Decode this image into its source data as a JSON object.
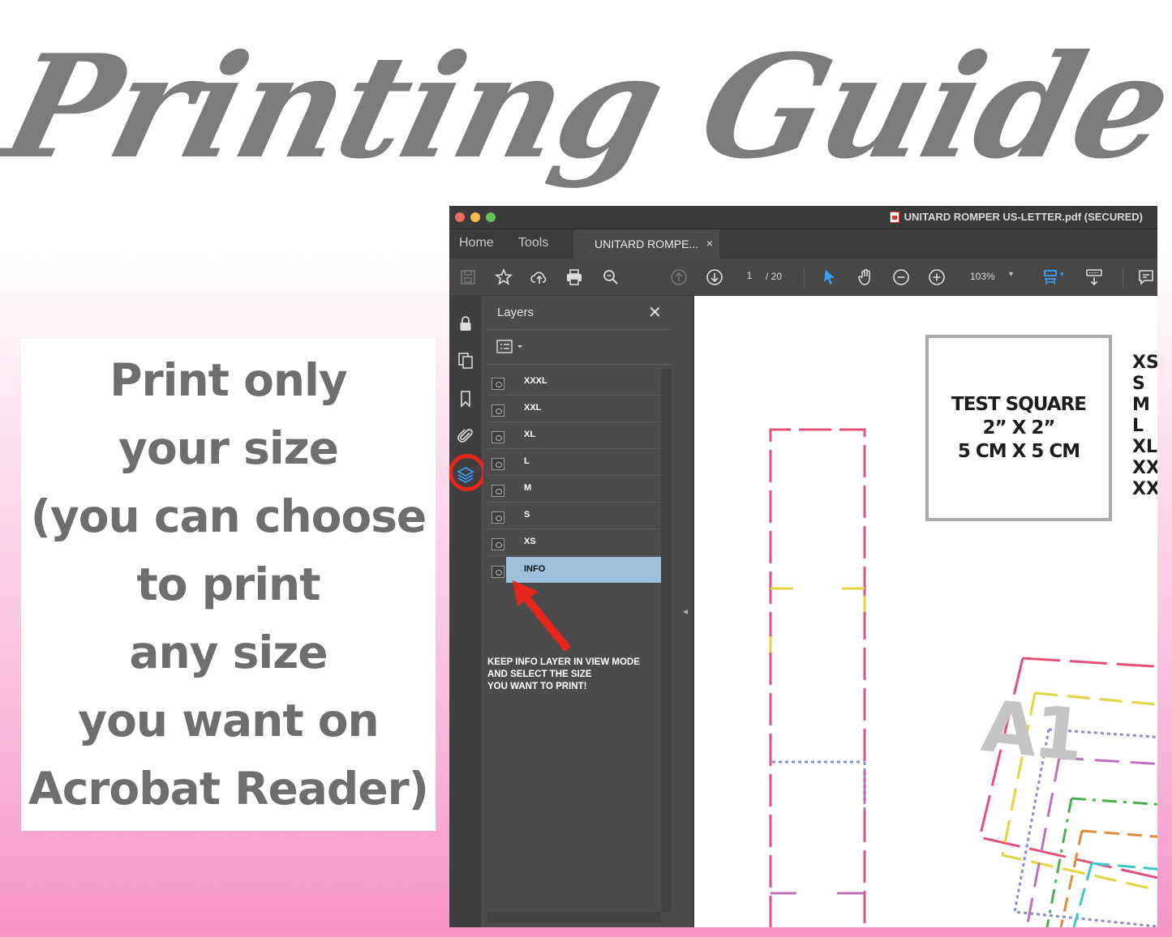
{
  "title": "Printing Guide",
  "card": {
    "lines": [
      "Print only",
      "your size",
      "(you can choose",
      "to print",
      "any size",
      "you want on",
      "Acrobat Reader)"
    ]
  },
  "window": {
    "title": "UNITARD ROMPER US-LETTER.pdf (SECURED)",
    "tabs": {
      "home": "Home",
      "tools": "Tools",
      "document": "UNITARD ROMPE...",
      "close": "×"
    },
    "toolbar": {
      "page_current": "1",
      "page_total": "/ 20",
      "zoom": "103%"
    },
    "layers_panel": {
      "title": "Layers",
      "close": "✕",
      "layers": [
        {
          "name": "XXXL",
          "selected": false
        },
        {
          "name": "XXL",
          "selected": false
        },
        {
          "name": "XL",
          "selected": false
        },
        {
          "name": "L",
          "selected": false
        },
        {
          "name": "M",
          "selected": false
        },
        {
          "name": "S",
          "selected": false
        },
        {
          "name": "XS",
          "selected": false
        },
        {
          "name": "INFO",
          "selected": true
        }
      ],
      "note": [
        "KEEP INFO LAYER IN VIEW MODE",
        "AND SELECT THE SIZE",
        "YOU WANT TO PRINT!"
      ]
    },
    "document": {
      "test_square": [
        "TEST SQUARE",
        "2” X 2”",
        "5 CM X 5 CM"
      ],
      "sizes": [
        "XS",
        "S",
        "M",
        "L",
        "XL",
        "XXL",
        "XXXL"
      ],
      "piece_label": "A1"
    }
  },
  "colors": {
    "title": "#7c7c7c",
    "highlight_ring": "#e5261c",
    "layer_selected": "#9cc0dd",
    "accent_blue": "#3aa0ff"
  }
}
